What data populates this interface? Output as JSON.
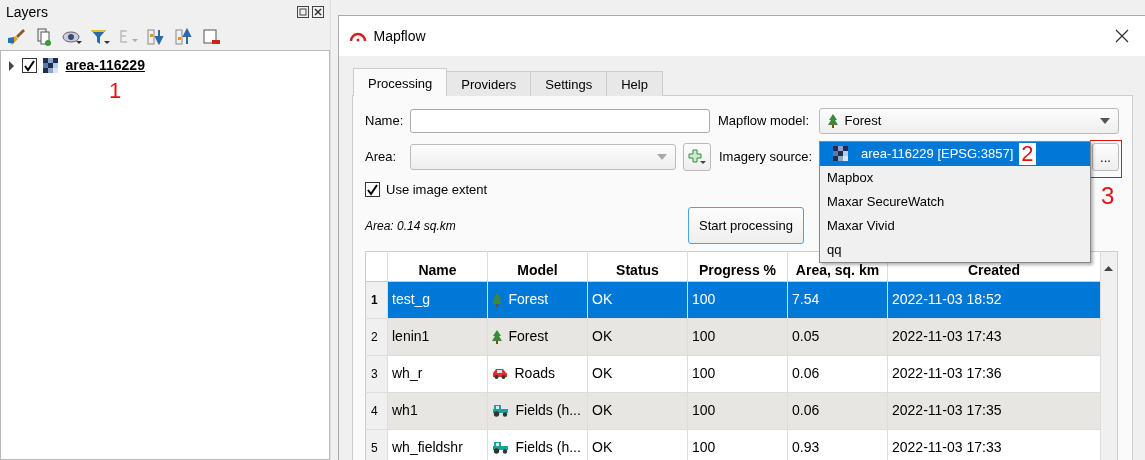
{
  "layers_panel": {
    "title": "Layers",
    "layers": [
      {
        "name": "area-116229",
        "checked": true,
        "expanded": false,
        "annotation": "1"
      }
    ]
  },
  "dialog": {
    "title": "Mapflow",
    "tabs": [
      {
        "label": "Processing",
        "selected": true
      },
      {
        "label": "Providers",
        "selected": false
      },
      {
        "label": "Settings",
        "selected": false
      },
      {
        "label": "Help",
        "selected": false
      }
    ],
    "name_label": "Name:",
    "model_label": "Mapflow model:",
    "model": {
      "label": "Forest",
      "kind": "forest"
    },
    "area_label": "Area:",
    "imagery_label": "Imagery source:",
    "imagery_options": [
      {
        "label": "area-116229 [EPSG:3857]",
        "kind": "layer",
        "selected": true,
        "annotation": "2"
      },
      {
        "label": "Mapbox",
        "kind": "provider",
        "selected": false
      },
      {
        "label": "Maxar SecureWatch",
        "kind": "provider",
        "selected": false
      },
      {
        "label": "Maxar Vivid",
        "kind": "provider",
        "selected": false
      },
      {
        "label": "qq",
        "kind": "provider",
        "selected": false
      }
    ],
    "more_button": {
      "label": "...",
      "annotation": "3"
    },
    "use_extent": {
      "label": "Use image extent",
      "checked": true
    },
    "area_info": "Area: 0.14 sq.km",
    "start_button": "Start processing",
    "table": {
      "columns": [
        "Name",
        "Model",
        "Status",
        "Progress %",
        "Area, sq. km",
        "Created"
      ],
      "rows": [
        {
          "index": "1",
          "selected": true,
          "cells": [
            "test_g",
            {
              "label": "Forest",
              "kind": "forest"
            },
            "OK",
            "100",
            "7.54",
            "2022-11-03 18:52"
          ]
        },
        {
          "index": "2",
          "selected": false,
          "cells": [
            "lenin1",
            {
              "label": "Forest",
              "kind": "forest"
            },
            "OK",
            "100",
            "0.05",
            "2022-11-03 17:43"
          ]
        },
        {
          "index": "3",
          "selected": false,
          "cells": [
            "wh_r",
            {
              "label": "Roads",
              "kind": "roads"
            },
            "OK",
            "100",
            "0.06",
            "2022-11-03 17:36"
          ]
        },
        {
          "index": "4",
          "selected": false,
          "cells": [
            "wh1",
            {
              "label": "Fields (h...",
              "kind": "fields"
            },
            "OK",
            "100",
            "0.06",
            "2022-11-03 17:35"
          ]
        },
        {
          "index": "5",
          "selected": false,
          "cells": [
            "wh_fieldshr",
            {
              "label": "Fields (h...",
              "kind": "fields"
            },
            "OK",
            "100",
            "0.93",
            "2022-11-03 17:33"
          ]
        }
      ]
    }
  }
}
